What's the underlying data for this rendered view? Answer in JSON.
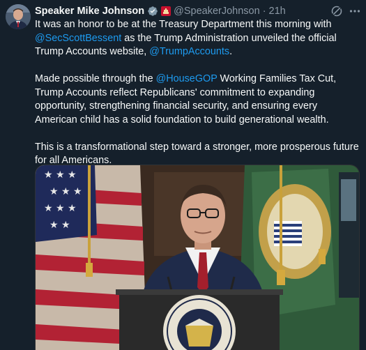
{
  "author": {
    "name": "Speaker Mike Johnson",
    "handle": "@SpeakerJohnson",
    "separator": "·",
    "time": "21h"
  },
  "tweet": {
    "p1_a": "It was an honor to be at the Treasury Department this morning with ",
    "p1_mention1": "@SecScottBessent",
    "p1_b": " as the Trump Administration unveiled the official Trump Accounts website, ",
    "p1_mention2": "@TrumpAccounts",
    "p1_c": ".",
    "p2_a": "Made possible through the ",
    "p2_mention": "@HouseGOP",
    "p2_b": " Working Families Tax Cut, Trump Accounts reflect Republicans' commitment to expanding opportunity, strengthening financial security, and ensuring every American child has a solid foundation to build generational wealth.",
    "p3": "This is a transformational step toward a stronger, more prosperous future for all Americans."
  },
  "media": {
    "seal_text": "DEPARTMENT OF THE TREASURY"
  },
  "icons": {
    "verified": "verified-badge-icon",
    "affiliate": "house-affiliate-badge-icon",
    "grok": "grok-icon",
    "more": "more-icon"
  },
  "colors": {
    "background": "#15202b",
    "text": "#f7f9f9",
    "secondary": "#8b98a5",
    "link": "#1d9bf0"
  }
}
